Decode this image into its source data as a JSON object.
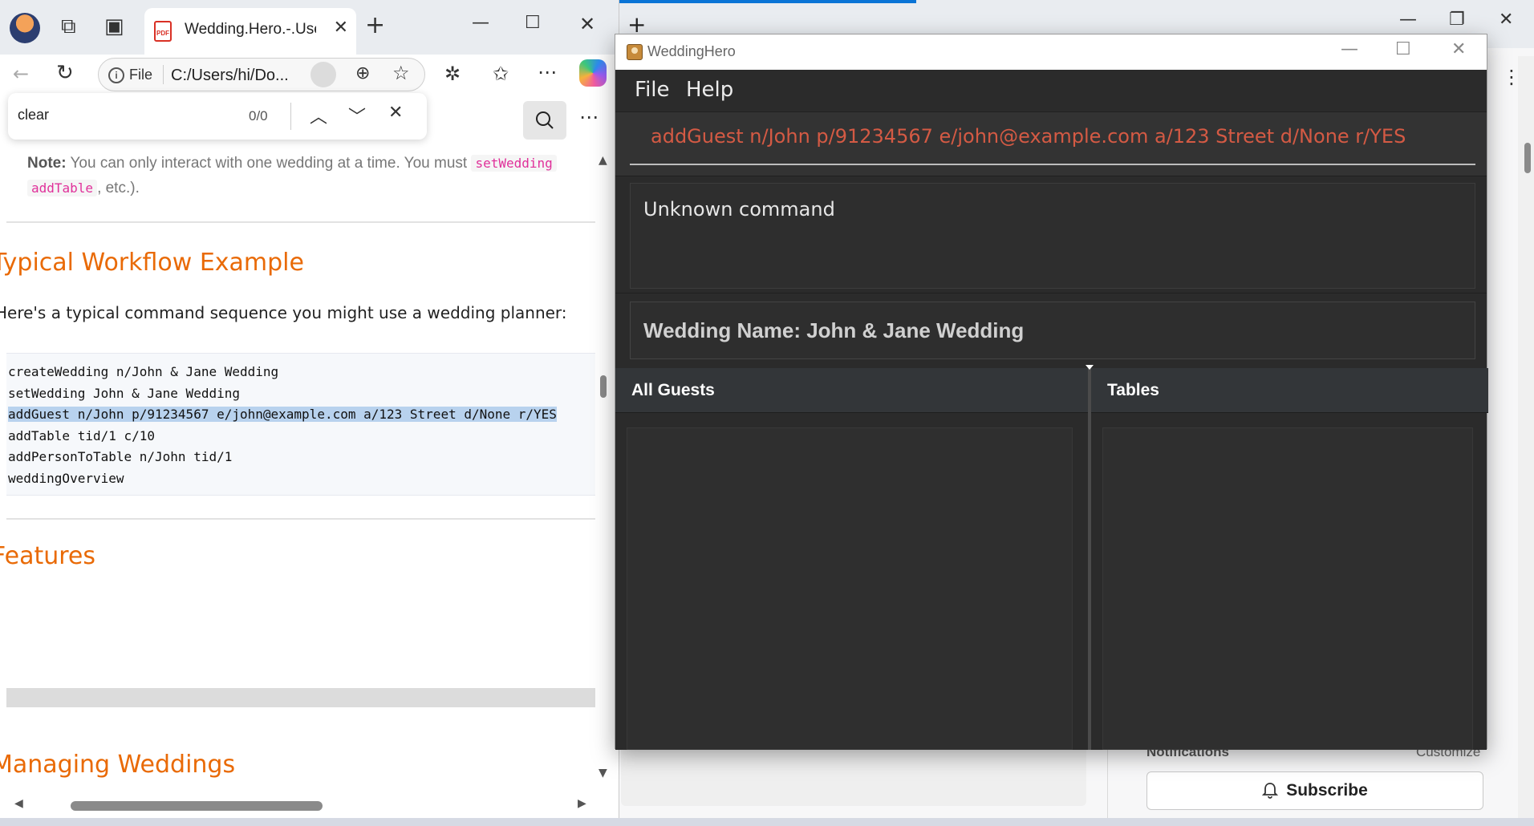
{
  "background_window": {
    "notifications_label": "Notifications",
    "customize_label": "Customize",
    "subscribe_label": "Subscribe"
  },
  "browser": {
    "tab_title": "Wedding.Hero.-.User",
    "address_chip": "File",
    "address_url": "C:/Users/hi/Do...",
    "find": {
      "query": "clear",
      "count": "0/0"
    }
  },
  "document": {
    "note_label": "Note:",
    "note_text": " You can only interact with one wedding at a time. You must ",
    "note_code1": "setWedding",
    "note_code2": "addTable",
    "note_tail": ", etc.).",
    "heading_workflow": "Typical Workflow Example",
    "workflow_intro": "Here's a typical command sequence you might use a wedding planner:",
    "code_lines": [
      "createWedding n/John & Jane Wedding",
      "setWedding John & Jane Wedding",
      "addGuest n/John p/91234567 e/john@example.com a/123 Street d/None r/YES",
      "addTable tid/1 c/10",
      "addPersonToTable n/John tid/1",
      "weddingOverview"
    ],
    "highlighted_line_index": 2,
    "heading_features": "Features",
    "heading_managing": "Managing Weddings"
  },
  "app": {
    "window_title": "WeddingHero",
    "menu": [
      "File",
      "Help"
    ],
    "command_input": "addGuest n/John p/91234567 e/john@example.com a/123 Street d/None r/YES",
    "command_error_color": "#d45a44",
    "result_message": "Unknown command",
    "wedding_name": "Wedding Name: John & Jane Wedding",
    "panel_guests_title": "All Guests",
    "panel_tables_title": "Tables"
  },
  "colors": {
    "heading_orange": "#e96a06",
    "inline_code_pink": "#e0309a",
    "selection_blue": "#b8d2ee",
    "app_dark": "#2b2b2b"
  }
}
